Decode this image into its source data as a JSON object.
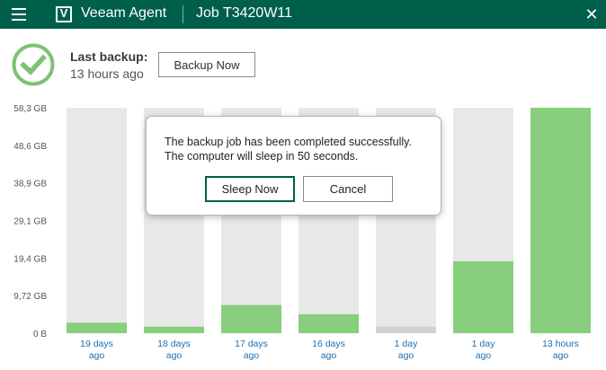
{
  "titlebar": {
    "logo_letter": "V",
    "app_name": "Veeam Agent",
    "job_name": "Job T3420W11",
    "close_glyph": "✕"
  },
  "status": {
    "label": "Last backup:",
    "time": "13 hours ago",
    "icon": "checkmark-success-icon",
    "icon_color": "#7dc272"
  },
  "actions": {
    "backup_now": "Backup Now"
  },
  "dialog": {
    "line1": "The backup job has been completed successfully.",
    "line2": "The computer will sleep in 50 seconds.",
    "sleep_now": "Sleep Now",
    "cancel": "Cancel"
  },
  "chart_data": {
    "type": "bar",
    "title": "",
    "xlabel": "",
    "ylabel": "",
    "y_ticks": [
      "58,3 GB",
      "48,6 GB",
      "38,9 GB",
      "29,1 GB",
      "19,4 GB",
      "9,72 GB",
      "0 B"
    ],
    "ylim": [
      0,
      58.3
    ],
    "categories": [
      [
        "19 days",
        "ago"
      ],
      [
        "18 days",
        "ago"
      ],
      [
        "17 days",
        "ago"
      ],
      [
        "16 days",
        "ago"
      ],
      [
        "1 day",
        "ago"
      ],
      [
        "1 day",
        "ago"
      ],
      [
        "13 hours",
        "ago"
      ]
    ],
    "values_gb": [
      2.7,
      1.7,
      7.3,
      4.9,
      1.7,
      18.6,
      58.3
    ],
    "bar_status": [
      "success",
      "success",
      "success",
      "success",
      "none",
      "success",
      "success"
    ],
    "colors": {
      "success": "#88cf7d",
      "none": "#d2d2d2",
      "column_background": "#e8e8e8",
      "tick_label": "#1a6fb3"
    }
  }
}
